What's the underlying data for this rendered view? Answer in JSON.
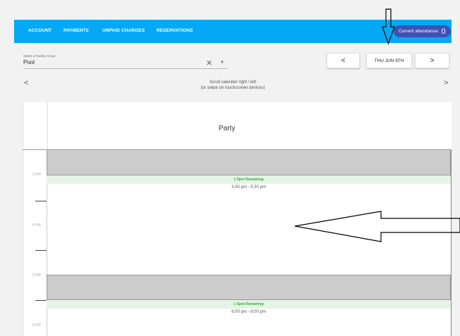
{
  "nav": {
    "items": [
      "ACCOUNT",
      "PAYMENTS",
      "UNPAID CHARGES",
      "RESERVATIONS"
    ],
    "attendance_label": "Current attendance:",
    "attendance_count": "0"
  },
  "facility": {
    "label": "Select a Facility Group",
    "value": "Pool"
  },
  "date_nav": {
    "prev": "<",
    "date": "THU JUN 9TH",
    "next": ">"
  },
  "scroll_hint": {
    "line1": "Scroll calender right / left",
    "line2": "(or swipe on touchscreen devices)",
    "left": "<",
    "right": ">"
  },
  "calendar": {
    "column_title": "Party",
    "times": [
      "3 PM",
      "4 PM",
      "5 PM",
      "6 PM"
    ],
    "slots": [
      {
        "status": "1 Spot Remaining",
        "range": "3:30 pm - 5:30 pm"
      },
      {
        "status": "1 Spot Remaining",
        "range": "6:00 pm - 8:00 pm"
      }
    ]
  },
  "colors": {
    "navbar": "#03a9f4",
    "attendance_badge": "#3f51b5",
    "available_bg": "#e6f4e6",
    "available_text": "#33aa33",
    "blocked": "#cccccc"
  }
}
